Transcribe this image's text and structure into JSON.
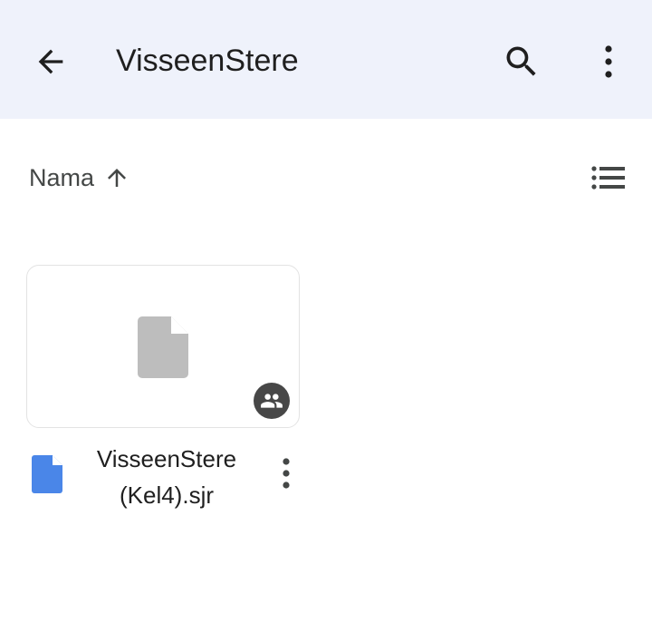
{
  "appbar": {
    "title": "VisseenStere",
    "back_icon": "arrow-back-icon",
    "search_icon": "search-icon",
    "more_icon": "more-vert-icon"
  },
  "sortbar": {
    "sort_label": "Nama",
    "sort_direction_icon": "arrow-up-icon",
    "view_toggle_icon": "list-view-icon"
  },
  "files": [
    {
      "name_line1": "VisseenStere",
      "name_line2": "(Kel4).sjr",
      "type_icon": "file-icon",
      "shared_icon": "shared-people-icon",
      "more_icon": "more-vert-icon"
    }
  ],
  "colors": {
    "appbar_bg": "#eff2fb",
    "file_icon_blue": "#4a86e8",
    "thumb_gray": "#bdbdbd",
    "shared_badge": "#474747"
  }
}
